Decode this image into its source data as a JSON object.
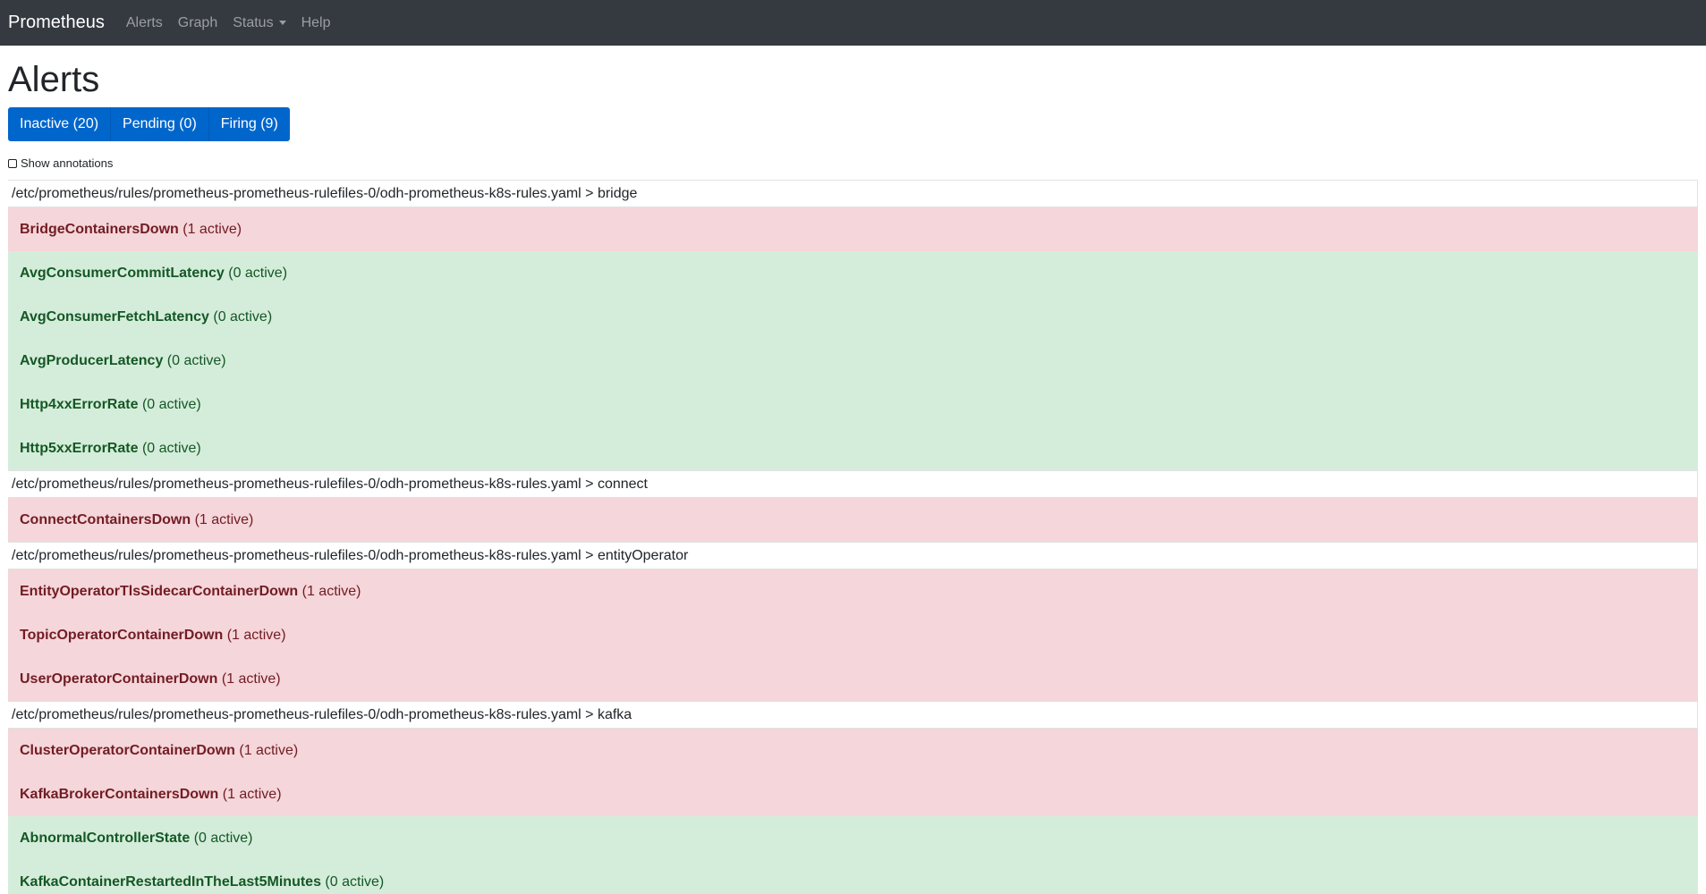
{
  "navbar": {
    "brand": "Prometheus",
    "links": [
      {
        "label": "Alerts"
      },
      {
        "label": "Graph"
      },
      {
        "label": "Status"
      },
      {
        "label": "Help"
      }
    ]
  },
  "page": {
    "title": "Alerts"
  },
  "filters": {
    "inactive_label": "Inactive (20)",
    "pending_label": "Pending (0)",
    "firing_label": "Firing (9)"
  },
  "annotations_toggle": {
    "label": "Show annotations",
    "checked": false
  },
  "colors": {
    "navbar_bg": "#343a40",
    "button_bg": "#0066cc",
    "firing_bg": "#f5d6da",
    "firing_text": "#721c24",
    "inactive_bg": "#d4eddb",
    "inactive_text": "#155724"
  },
  "groups": [
    {
      "header": "/etc/prometheus/rules/prometheus-prometheus-rulefiles-0/odh-prometheus-k8s-rules.yaml > bridge",
      "rules": [
        {
          "name": "BridgeContainersDown",
          "count": "(1 active)",
          "state": "firing"
        },
        {
          "name": "AvgConsumerCommitLatency",
          "count": "(0 active)",
          "state": "inactive"
        },
        {
          "name": "AvgConsumerFetchLatency",
          "count": "(0 active)",
          "state": "inactive"
        },
        {
          "name": "AvgProducerLatency",
          "count": "(0 active)",
          "state": "inactive"
        },
        {
          "name": "Http4xxErrorRate",
          "count": "(0 active)",
          "state": "inactive"
        },
        {
          "name": "Http5xxErrorRate",
          "count": "(0 active)",
          "state": "inactive"
        }
      ]
    },
    {
      "header": "/etc/prometheus/rules/prometheus-prometheus-rulefiles-0/odh-prometheus-k8s-rules.yaml > connect",
      "rules": [
        {
          "name": "ConnectContainersDown",
          "count": "(1 active)",
          "state": "firing"
        }
      ]
    },
    {
      "header": "/etc/prometheus/rules/prometheus-prometheus-rulefiles-0/odh-prometheus-k8s-rules.yaml > entityOperator",
      "rules": [
        {
          "name": "EntityOperatorTlsSidecarContainerDown",
          "count": "(1 active)",
          "state": "firing"
        },
        {
          "name": "TopicOperatorContainerDown",
          "count": "(1 active)",
          "state": "firing"
        },
        {
          "name": "UserOperatorContainerDown",
          "count": "(1 active)",
          "state": "firing"
        }
      ]
    },
    {
      "header": "/etc/prometheus/rules/prometheus-prometheus-rulefiles-0/odh-prometheus-k8s-rules.yaml > kafka",
      "rules": [
        {
          "name": "ClusterOperatorContainerDown",
          "count": "(1 active)",
          "state": "firing"
        },
        {
          "name": "KafkaBrokerContainersDown",
          "count": "(1 active)",
          "state": "firing"
        },
        {
          "name": "AbnormalControllerState",
          "count": "(0 active)",
          "state": "inactive"
        },
        {
          "name": "KafkaContainerRestartedInTheLast5Minutes",
          "count": "(0 active)",
          "state": "inactive"
        }
      ]
    }
  ]
}
